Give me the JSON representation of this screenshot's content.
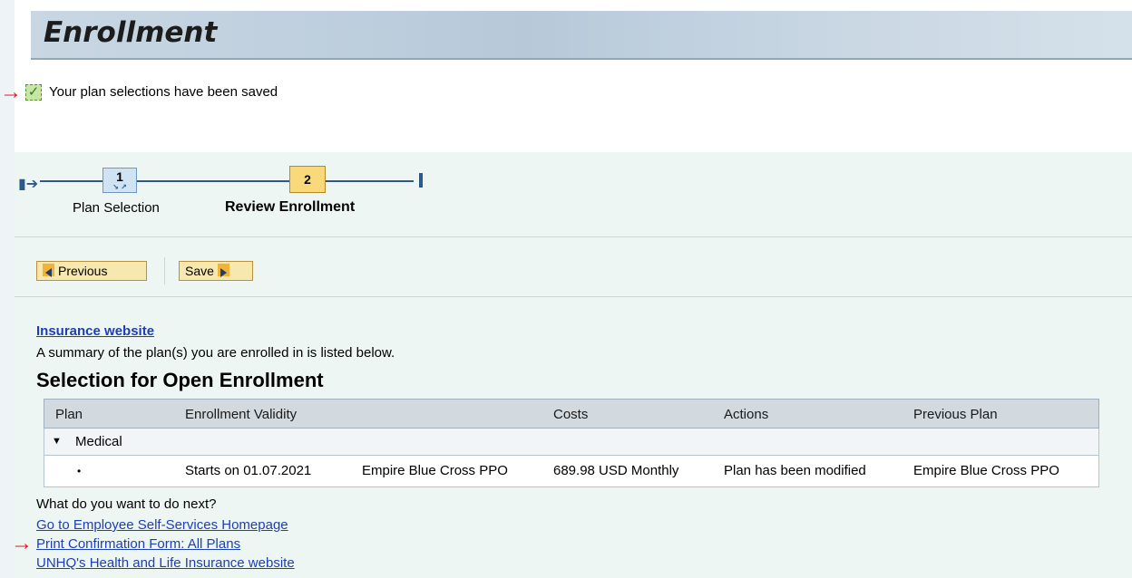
{
  "header": {
    "title": "Enrollment"
  },
  "message": {
    "text": "Your plan selections have been saved"
  },
  "roadmap": {
    "steps": [
      {
        "number": "1",
        "label": "Plan Selection"
      },
      {
        "number": "2",
        "label": "Review Enrollment"
      }
    ]
  },
  "toolbar": {
    "previous_label": "Previous",
    "save_label": "Save"
  },
  "links": {
    "insurance_website": "Insurance website"
  },
  "summary_text": "A summary of the plan(s) you are enrolled in is listed below.",
  "section_title": "Selection for Open Enrollment",
  "table": {
    "columns": [
      "Plan",
      "Enrollment Validity",
      "Costs",
      "Actions",
      "Previous Plan"
    ],
    "group": {
      "label": "Medical"
    },
    "row": {
      "bullet": "•",
      "validity": "Starts on 01.07.2021",
      "plan_name": "Empire Blue Cross PPO",
      "cost": "689.98 USD Monthly",
      "action": "Plan has been modified",
      "previous_plan": "Empire Blue Cross PPO"
    }
  },
  "next": {
    "question": "What do you want to do next?",
    "links": [
      "Go to Employee Self-Services Homepage",
      "Print Confirmation Form: All Plans",
      "UNHQ's Health and Life Insurance website"
    ]
  },
  "icons": {
    "success": "checkmark-icon",
    "annotation": "red-arrow-icon",
    "roadmap_start": "roadmap-start-icon",
    "roadmap_end": "roadmap-end-icon",
    "expand": "triangle-down-icon"
  },
  "colors": {
    "title_bar": "#b7c9d9",
    "content_bg": "#eef6f4",
    "button_bg": "#f7e8b0",
    "link": "#1d3fb4",
    "active_step": "#f9d97a",
    "annotation_arrow": "#e2182a"
  }
}
